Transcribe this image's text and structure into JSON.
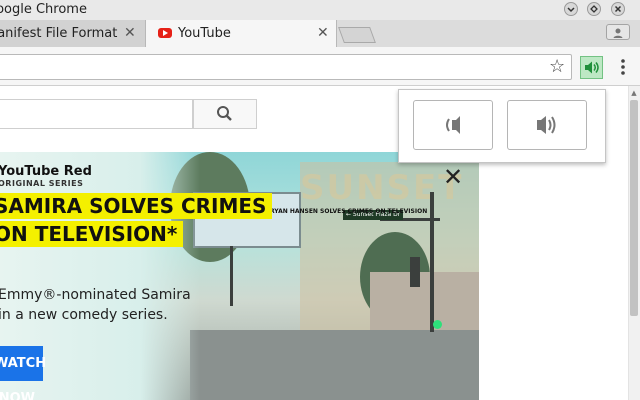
{
  "window": {
    "title": "Google Chrome",
    "buttons": [
      "minimize",
      "maximize",
      "close"
    ]
  },
  "tabs": [
    {
      "label": "Manifest File Format",
      "active": false,
      "icon": null
    },
    {
      "label": "YouTube",
      "active": true,
      "icon": "youtube-favicon"
    }
  ],
  "toolbar": {
    "url": "",
    "bookmark_icon": "star-outline",
    "extension_icon": "speaker-volume",
    "menu_icon": "three-dots-vertical"
  },
  "youtube": {
    "search_placeholder": "",
    "search_icon": "magnifier"
  },
  "banner": {
    "brand": "YouTube Red",
    "series_label": "ORIGINAL SERIES",
    "headline_line1": "SAMIRA SOLVES CRIMES",
    "headline_line2": "ON TELEVISION*",
    "desc_line1": "Emmy®-nominated Samira",
    "desc_line2": "in a new comedy series.",
    "cta": "WATCH NOW",
    "street_sign": "← Sunset Plaza Dr",
    "building_sign": "SUNSET",
    "billboard_text": "RYAN HANSEN SOLVES CRIMES ON TELEVISION"
  },
  "volume_popup": {
    "buttons": [
      {
        "icon": "volume-down"
      },
      {
        "icon": "volume-up"
      }
    ]
  },
  "colors": {
    "extension_active_bg": "#bde8c4",
    "extension_active_border": "#73c283",
    "youtube_red": "#e62117",
    "headline_yellow": "#f4f000",
    "cta_blue": "#1a73e8"
  }
}
